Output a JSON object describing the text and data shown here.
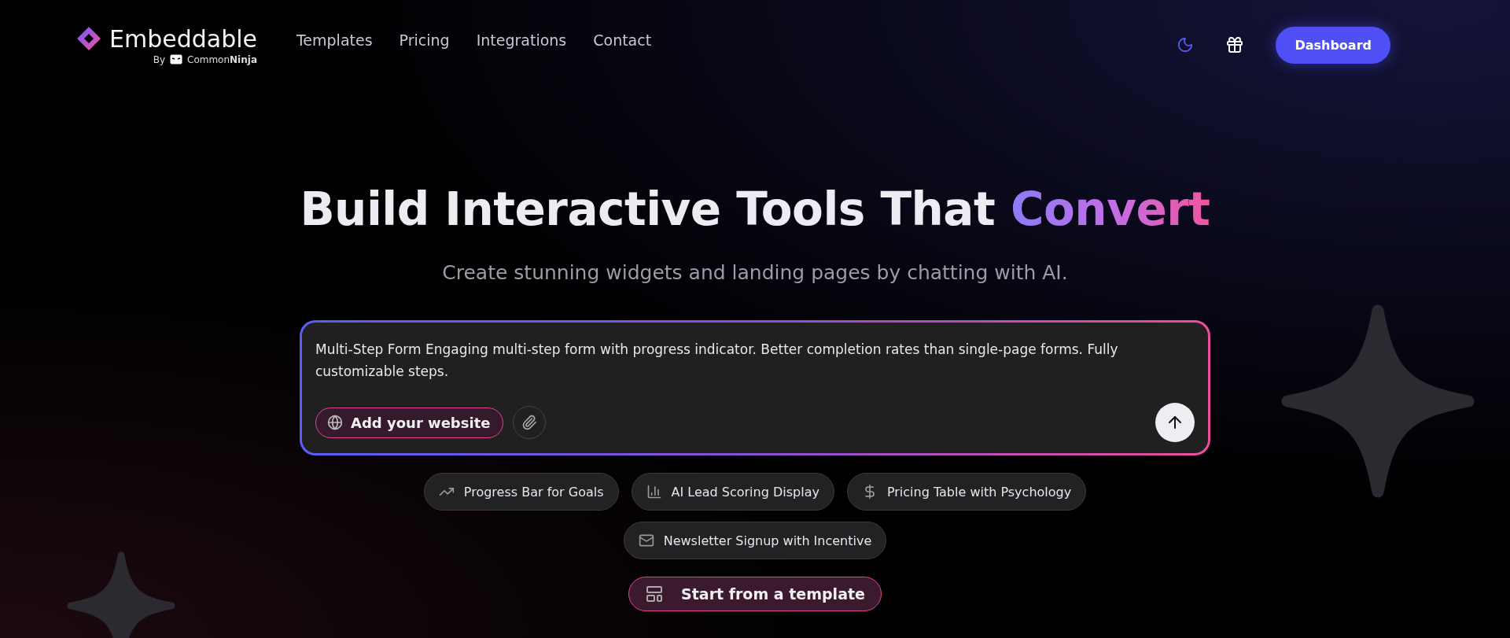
{
  "brand": {
    "name": "Embeddable",
    "byline": "By",
    "maker": "Common**Ninja**"
  },
  "nav": [
    {
      "label": "Templates"
    },
    {
      "label": "Pricing"
    },
    {
      "label": "Integrations"
    },
    {
      "label": "Contact"
    }
  ],
  "actions": {
    "dashboard": "Dashboard"
  },
  "hero": {
    "title": "Build Interactive Tools That ",
    "highlight": "Convert",
    "subtitle": "Create stunning widgets and landing pages by chatting with AI."
  },
  "prompt": {
    "value": "Multi-Step Form Engaging multi-step form with progress indicator. Better completion rates than single-page forms. Fully customizable steps.",
    "website_button": "Add your website"
  },
  "suggestions": [
    [
      {
        "kind": "trend",
        "label": "Progress Bar for Goals"
      },
      {
        "kind": "chart",
        "label": "AI Lead Scoring Display"
      },
      {
        "kind": "dollar",
        "label": "Pricing Table with Psychology"
      }
    ],
    [
      {
        "kind": "mail",
        "label": "Newsletter Signup with Incentive"
      }
    ]
  ],
  "template_button": "Start from a template"
}
